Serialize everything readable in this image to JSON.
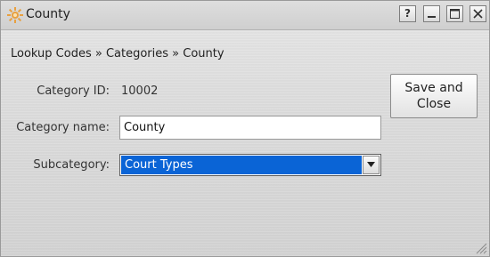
{
  "window": {
    "title": "County",
    "title_icon": "sun-gear-icon",
    "controls": {
      "help": "?"
    }
  },
  "breadcrumb": "Lookup Codes » Categories » County",
  "form": {
    "category_id_label": "Category ID:",
    "category_id_value": "10002",
    "category_name_label": "Category name:",
    "category_name_value": "County",
    "subcategory_label": "Subcategory:",
    "subcategory_value": "Court Types"
  },
  "actions": {
    "save_close_label": "Save and\nClose"
  },
  "colors": {
    "selection": "#0a64d6",
    "window_bg": "#dcdcdc"
  }
}
